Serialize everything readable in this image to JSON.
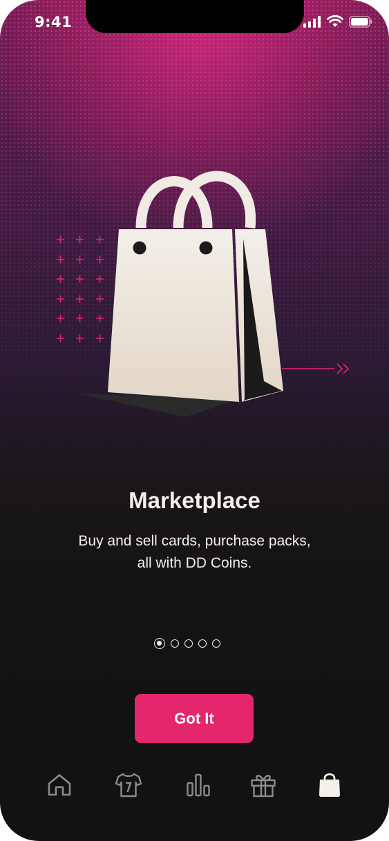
{
  "status_bar": {
    "time": "9:41",
    "icons": [
      "cellular-signal-icon",
      "wifi-icon",
      "battery-icon"
    ]
  },
  "onboarding": {
    "illustration": "shopping-bag-icon",
    "title": "Marketplace",
    "description": "Buy and sell cards, purchase packs, all with DD Coins.",
    "page_count": 5,
    "active_page": 1
  },
  "cta": {
    "label": "Got It"
  },
  "tab_bar": {
    "items": [
      {
        "icon": "home-icon",
        "active": false
      },
      {
        "icon": "jersey-icon",
        "active": false
      },
      {
        "icon": "bar-chart-icon",
        "active": false
      },
      {
        "icon": "gift-icon",
        "active": false
      },
      {
        "icon": "shopping-bag-icon",
        "active": true
      }
    ]
  },
  "colors": {
    "accent": "#e4266d",
    "background": "#121212",
    "text": "#f4f0ea",
    "inactive_icon": "#8c8c8c"
  }
}
